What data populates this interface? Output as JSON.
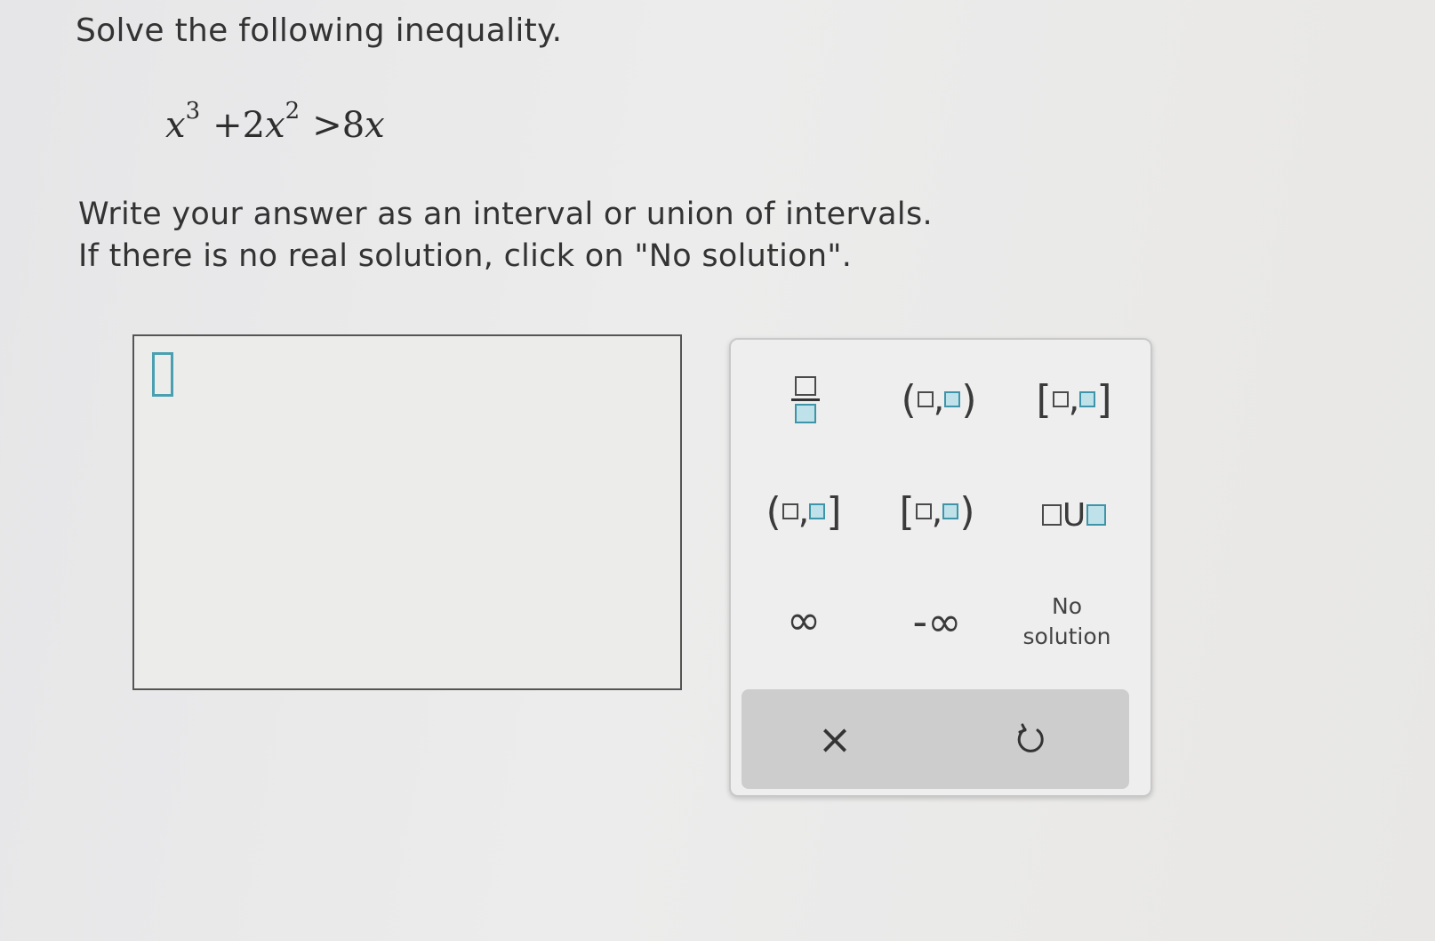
{
  "question": {
    "prompt": "Solve the following inequality.",
    "instructions_line1": "Write your answer as an interval or union of intervals.",
    "instructions_line2": "If there is no real solution, click on \"No solution\"."
  },
  "equation": {
    "var": "x",
    "exp1": "3",
    "plus_term": "+2",
    "exp2": "2",
    "op": ">",
    "rhs": "8"
  },
  "keypad": {
    "open_paren": "(",
    "close_paren": ")",
    "open_bracket": "[",
    "close_bracket": "]",
    "comma": ",",
    "union": "U",
    "infinity": "∞",
    "neg_infinity": "-∞",
    "no_solution_line1": "No",
    "no_solution_line2": "solution",
    "clear": "×"
  },
  "icons": {
    "clear": "close-icon",
    "undo": "undo-icon"
  },
  "colors": {
    "accent": "#3e94a8",
    "accent_fill": "#bfe2ea"
  }
}
